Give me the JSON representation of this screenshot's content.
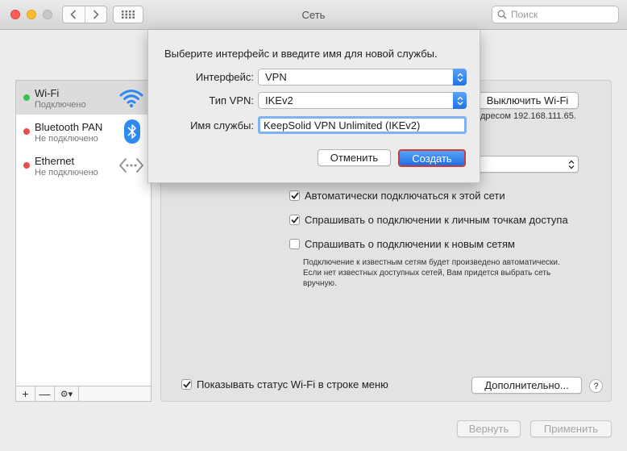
{
  "window": {
    "title": "Сеть",
    "search_placeholder": "Поиск"
  },
  "sidebar": {
    "services": [
      {
        "name": "Wi-Fi",
        "status": "Подключено",
        "status_color": "#31c54b",
        "icon": "wifi-icon",
        "selected": true
      },
      {
        "name": "Bluetooth PAN",
        "status": "Не подключено",
        "status_color": "#ec4b4b",
        "icon": "bluetooth-icon"
      },
      {
        "name": "Ethernet",
        "status": "Не подключено",
        "status_color": "#ec4b4b",
        "icon": "ethernet-icon"
      }
    ],
    "tools": {
      "add": "+",
      "remove": "—",
      "gear": "⚙▾"
    }
  },
  "main": {
    "turn_off_wifi": "Выключить Wi-Fi",
    "address_text": "дресом 192.168.111.65.",
    "checkboxes": [
      {
        "label": "Автоматически подключаться к этой сети",
        "checked": true
      },
      {
        "label": "Спрашивать о подключении к личным точкам доступа",
        "checked": true
      },
      {
        "label": "Спрашивать о подключении к новым сетям",
        "checked": false
      }
    ],
    "note": "Подключение к известным сетям будет произведено автоматически. Если нет известных доступных сетей, Вам придется выбрать сеть вручную.",
    "show_status": {
      "label": "Показывать статус Wi-Fi в строке меню",
      "checked": true
    },
    "advanced": "Дополнительно...",
    "help": "?",
    "revert": "Вернуть",
    "apply": "Применить"
  },
  "sheet": {
    "prompt": "Выберите интерфейс и введите имя для новой службы.",
    "interface_label": "Интерфейс:",
    "interface_value": "VPN",
    "vpn_type_label": "Тип VPN:",
    "vpn_type_value": "IKEv2",
    "service_name_label": "Имя службы:",
    "service_name_value": "KeepSolid VPN Unlimited (IKEv2)",
    "cancel": "Отменить",
    "create": "Создать"
  }
}
